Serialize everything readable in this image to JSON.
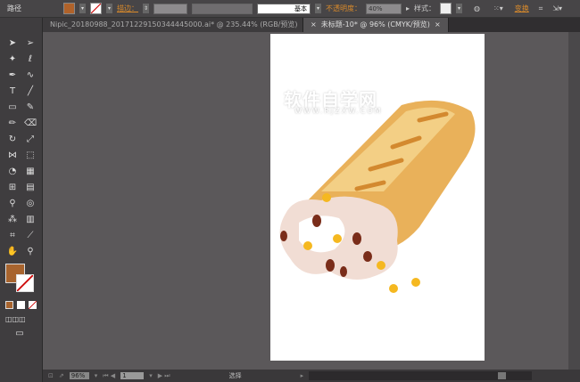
{
  "control_bar": {
    "selection_label": "路径",
    "stroke_label": "描边：",
    "stroke_style": "基本",
    "opacity_label": "不透明度：",
    "opacity_value": "40%",
    "style_label": "样式：",
    "transform_label": "变换",
    "fill_color": "#b0622a"
  },
  "tabs": [
    {
      "label": "Nipic_20180988_20171229150344445000.ai* @ 235.44% (RGB/预览)",
      "close": "×"
    },
    {
      "label": "未标题-10* @ 96% (CMYK/预览)",
      "close": "×"
    }
  ],
  "watermark": {
    "title": "软件自学网",
    "url": "WWW.RJZXW.COM"
  },
  "status_bar": {
    "zoom": "96%",
    "artboard": "1",
    "tool": "选择"
  }
}
